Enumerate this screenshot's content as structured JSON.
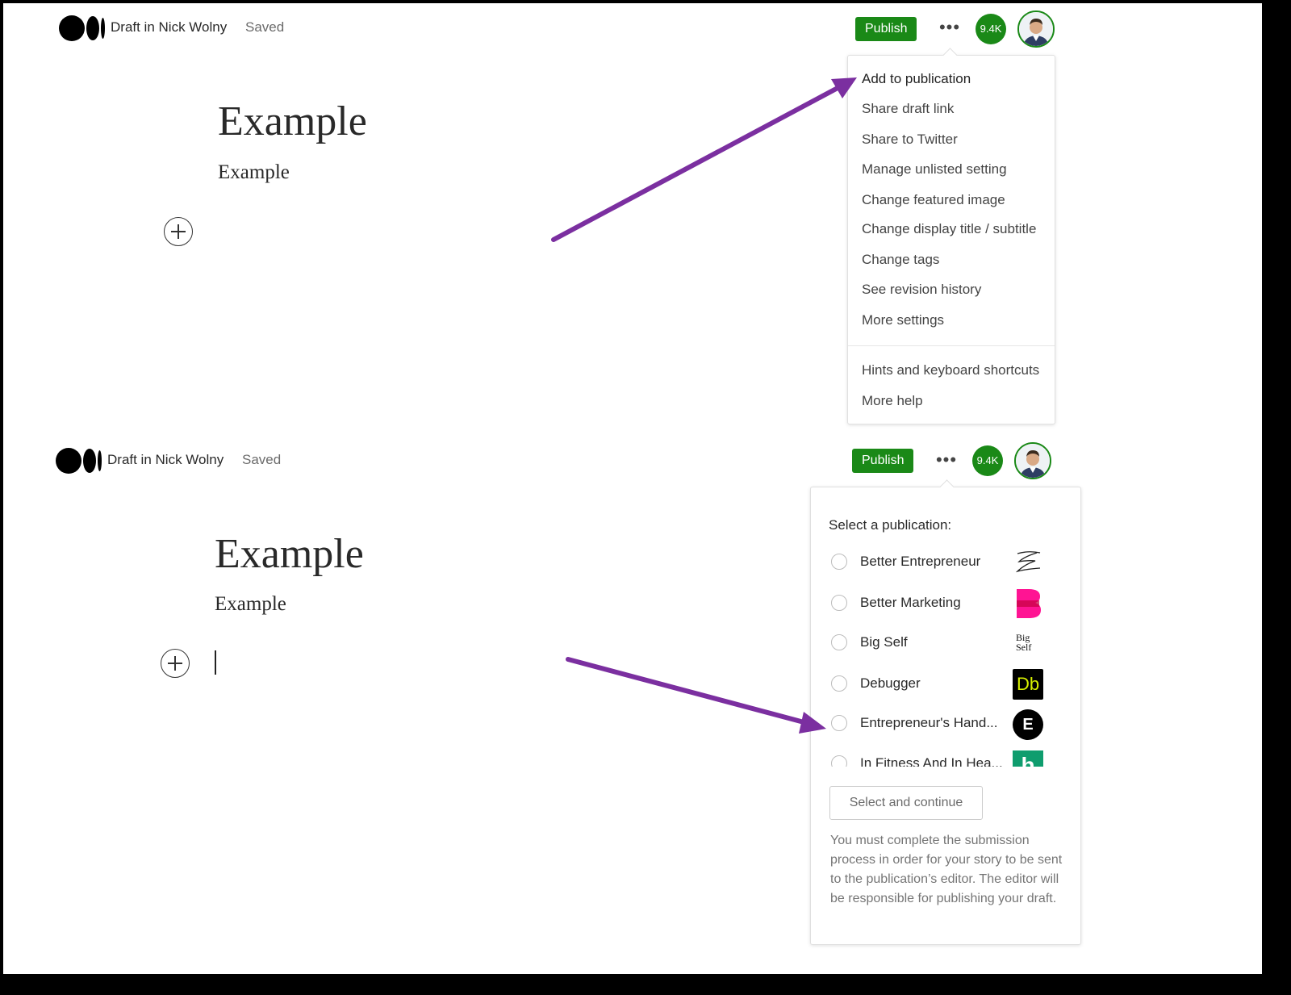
{
  "top": {
    "draft_label": "Draft in Nick Wolny",
    "saved_label": "Saved",
    "publish_label": "Publish",
    "more_label": "•••",
    "badge_label": "9.4K",
    "title": "Example",
    "subtitle": "Example",
    "menu": {
      "items": [
        "Add to publication",
        "Share draft link",
        "Share to Twitter",
        "Manage unlisted setting",
        "Change featured image",
        "Change display title / subtitle",
        "Change tags",
        "See revision history",
        "More settings"
      ],
      "help_items": [
        "Hints and keyboard shortcuts",
        "More help"
      ]
    }
  },
  "bottom": {
    "draft_label": "Draft in Nick Wolny",
    "saved_label": "Saved",
    "publish_label": "Publish",
    "more_label": "•••",
    "badge_label": "9.4K",
    "title": "Example",
    "subtitle": "Example",
    "panel": {
      "heading": "Select a publication:",
      "publications": [
        {
          "name": "Better Entrepreneur",
          "icon": "signature-e-icon"
        },
        {
          "name": "Better Marketing",
          "icon": "pink-b-icon"
        },
        {
          "name": "Big Self",
          "icon": "big-self-logo-icon"
        },
        {
          "name": "Debugger",
          "icon": "db-logo-icon"
        },
        {
          "name": "Entrepreneur's Hand...",
          "icon": "e-circle-icon"
        },
        {
          "name": "In Fitness And In Hea...",
          "icon": "green-h-icon"
        }
      ],
      "icon_text": {
        "big_self": "Big Self",
        "db": "Db",
        "e": "E",
        "h": "h"
      },
      "button_label": "Select and continue",
      "note": "You must complete the submission process in order for your story to be sent to the publication’s editor. The editor will be responsible for publishing your draft."
    }
  },
  "colors": {
    "accent_green": "#1a8917",
    "arrow_purple": "#7b2fa0"
  }
}
